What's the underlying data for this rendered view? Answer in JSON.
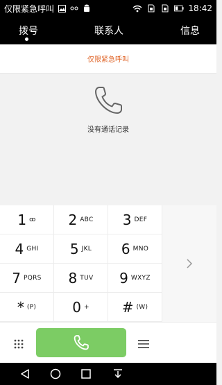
{
  "status_bar": {
    "carrier_text": "仅限紧急呼叫",
    "time": "18:42",
    "icons": [
      "image-icon",
      "voicemail-icon",
      "android-icon",
      "wifi-icon",
      "sim1-icon",
      "sim2-icon",
      "battery-icon"
    ]
  },
  "tabs": [
    {
      "label": "拨号",
      "active": true
    },
    {
      "label": "联系人",
      "active": false
    },
    {
      "label": "信息",
      "active": false
    }
  ],
  "banner": {
    "text": "仅限紧急呼叫",
    "color": "#e0662a"
  },
  "empty_state": {
    "text": "没有通话记录",
    "icon": "phone-icon"
  },
  "keypad": {
    "keys": [
      {
        "digit": "1",
        "letters": "ꝏ"
      },
      {
        "digit": "2",
        "letters": "ABC"
      },
      {
        "digit": "3",
        "letters": "DEF"
      },
      {
        "digit": "4",
        "letters": "GHI"
      },
      {
        "digit": "5",
        "letters": "JKL"
      },
      {
        "digit": "6",
        "letters": "MNO"
      },
      {
        "digit": "7",
        "letters": "PQRS"
      },
      {
        "digit": "8",
        "letters": "TUV"
      },
      {
        "digit": "9",
        "letters": "WXYZ"
      },
      {
        "digit": "*",
        "letters": "(P)"
      },
      {
        "digit": "0",
        "letters": "+"
      },
      {
        "digit": "#",
        "letters": "(W)"
      }
    ]
  },
  "action_bar": {
    "call_color": "#7ccc64"
  },
  "nav_bar": {
    "buttons": [
      "back-icon",
      "home-icon",
      "recents-icon",
      "notification-pulldown-icon"
    ]
  }
}
